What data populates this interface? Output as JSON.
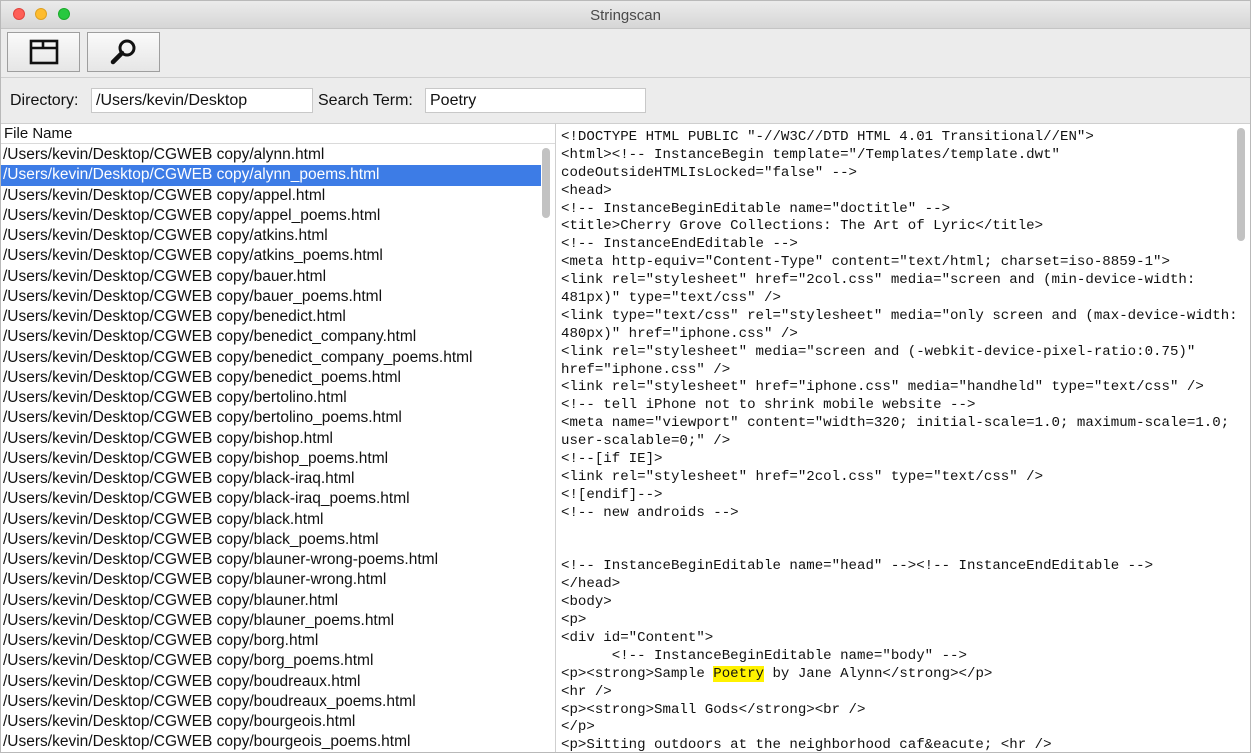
{
  "window": {
    "title": "Stringscan"
  },
  "toolbar": {
    "open_icon": "folder-icon",
    "search_icon": "magnifier-icon"
  },
  "form": {
    "directory_label": "Directory:",
    "directory_value": "/Users/kevin/Desktop",
    "search_label": "Search Term:",
    "search_value": "Poetry"
  },
  "file_list": {
    "header": "File Name",
    "selected_index": 1,
    "items": [
      "/Users/kevin/Desktop/CGWEB copy/alynn.html",
      "/Users/kevin/Desktop/CGWEB copy/alynn_poems.html",
      "/Users/kevin/Desktop/CGWEB copy/appel.html",
      "/Users/kevin/Desktop/CGWEB copy/appel_poems.html",
      "/Users/kevin/Desktop/CGWEB copy/atkins.html",
      "/Users/kevin/Desktop/CGWEB copy/atkins_poems.html",
      "/Users/kevin/Desktop/CGWEB copy/bauer.html",
      "/Users/kevin/Desktop/CGWEB copy/bauer_poems.html",
      "/Users/kevin/Desktop/CGWEB copy/benedict.html",
      "/Users/kevin/Desktop/CGWEB copy/benedict_company.html",
      "/Users/kevin/Desktop/CGWEB copy/benedict_company_poems.html",
      "/Users/kevin/Desktop/CGWEB copy/benedict_poems.html",
      "/Users/kevin/Desktop/CGWEB copy/bertolino.html",
      "/Users/kevin/Desktop/CGWEB copy/bertolino_poems.html",
      "/Users/kevin/Desktop/CGWEB copy/bishop.html",
      "/Users/kevin/Desktop/CGWEB copy/bishop_poems.html",
      "/Users/kevin/Desktop/CGWEB copy/black-iraq.html",
      "/Users/kevin/Desktop/CGWEB copy/black-iraq_poems.html",
      "/Users/kevin/Desktop/CGWEB copy/black.html",
      "/Users/kevin/Desktop/CGWEB copy/black_poems.html",
      "/Users/kevin/Desktop/CGWEB copy/blauner-wrong-poems.html",
      "/Users/kevin/Desktop/CGWEB copy/blauner-wrong.html",
      "/Users/kevin/Desktop/CGWEB copy/blauner.html",
      "/Users/kevin/Desktop/CGWEB copy/blauner_poems.html",
      "/Users/kevin/Desktop/CGWEB copy/borg.html",
      "/Users/kevin/Desktop/CGWEB copy/borg_poems.html",
      "/Users/kevin/Desktop/CGWEB copy/boudreaux.html",
      "/Users/kevin/Desktop/CGWEB copy/boudreaux_poems.html",
      "/Users/kevin/Desktop/CGWEB copy/bourgeois.html",
      "/Users/kevin/Desktop/CGWEB copy/bourgeois_poems.html"
    ]
  },
  "preview": {
    "highlight_term": "Poetry",
    "highlight_color": "#fff200",
    "lines": [
      "<!DOCTYPE HTML PUBLIC \"-//W3C//DTD HTML 4.01 Transitional//EN\">",
      "<html><!-- InstanceBegin template=\"/Templates/template.dwt\"",
      "codeOutsideHTMLIsLocked=\"false\" -->",
      "<head>",
      "<!-- InstanceBeginEditable name=\"doctitle\" -->",
      "<title>Cherry Grove Collections: The Art of Lyric</title>",
      "<!-- InstanceEndEditable -->",
      "<meta http-equiv=\"Content-Type\" content=\"text/html; charset=iso-8859-1\">",
      "<link rel=\"stylesheet\" href=\"2col.css\" media=\"screen and (min-device-width:",
      "481px)\" type=\"text/css\" />",
      "<link type=\"text/css\" rel=\"stylesheet\" media=\"only screen and (max-device-width:",
      "480px)\" href=\"iphone.css\" />",
      "<link rel=\"stylesheet\" media=\"screen and (-webkit-device-pixel-ratio:0.75)\"",
      "href=\"iphone.css\" />",
      "<link rel=\"stylesheet\" href=\"iphone.css\" media=\"handheld\" type=\"text/css\" />",
      "<!-- tell iPhone not to shrink mobile website -->",
      "<meta name=\"viewport\" content=\"width=320; initial-scale=1.0; maximum-scale=1.0;",
      "user-scalable=0;\" />",
      "<!--[if IE]>",
      "<link rel=\"stylesheet\" href=\"2col.css\" type=\"text/css\" />",
      "<![endif]-->",
      "<!-- new androids -->",
      "",
      "",
      "<!-- InstanceBeginEditable name=\"head\" --><!-- InstanceEndEditable -->",
      "</head>",
      "<body>",
      "<p>",
      "<div id=\"Content\">",
      "      <!-- InstanceBeginEditable name=\"body\" -->",
      "<p><strong>Sample Poetry by Jane Alynn</strong></p>",
      "<hr />",
      "<p><strong>Small Gods</strong><br />",
      "</p>",
      "<p>Sitting outdoors at the neighborhood caf&eacute; <hr />"
    ]
  }
}
